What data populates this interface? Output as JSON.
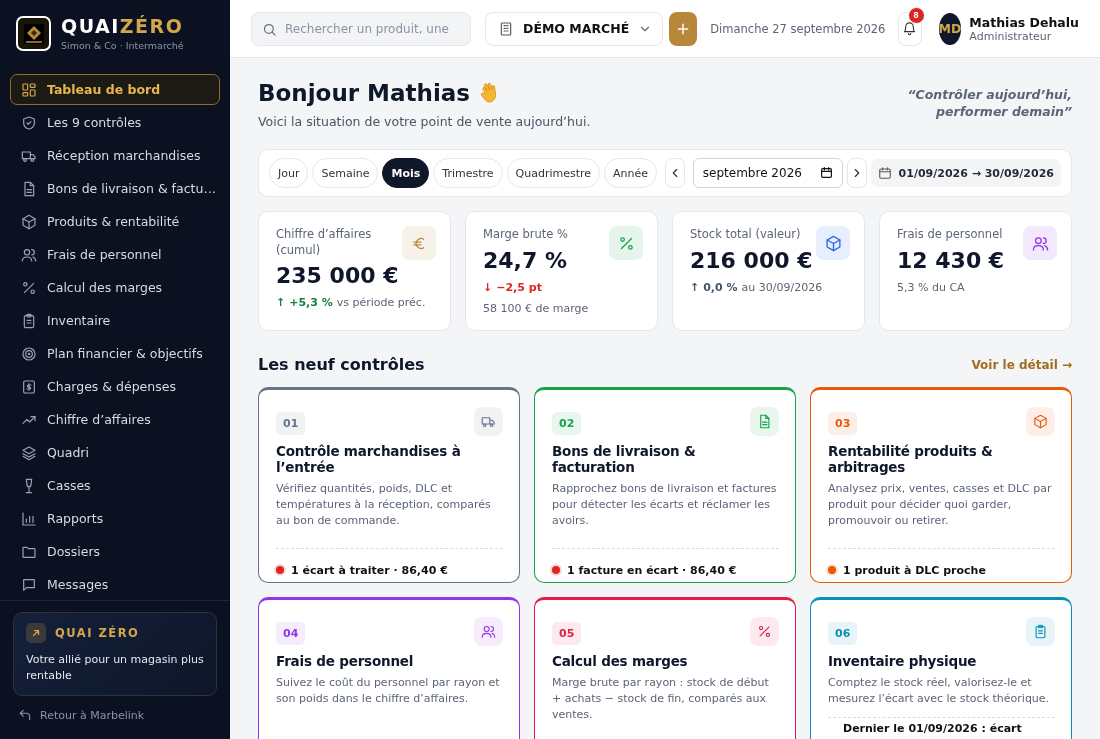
{
  "brand": {
    "name_main": "QUAI",
    "name_accent": "ZÉRO",
    "subtitle": "Simon & Co · Intermarché"
  },
  "sidebar": {
    "items": [
      {
        "label": "Tableau de bord",
        "selected": true
      },
      {
        "label": "Les 9 contrôles",
        "selected": false
      },
      {
        "label": "Réception marchandises",
        "selected": false
      },
      {
        "label": "Bons de livraison & factu…",
        "selected": false
      },
      {
        "label": "Produits & rentabilité",
        "selected": false
      },
      {
        "label": "Frais de personnel",
        "selected": false
      },
      {
        "label": "Calcul des marges",
        "selected": false
      },
      {
        "label": "Inventaire",
        "selected": false
      },
      {
        "label": "Plan financier & objectifs",
        "selected": false
      },
      {
        "label": "Charges & dépenses",
        "selected": false
      },
      {
        "label": "Chiffre d’affaires",
        "selected": false
      },
      {
        "label": "Quadri",
        "selected": false
      },
      {
        "label": "Casses",
        "selected": false
      },
      {
        "label": "Rapports",
        "selected": false
      },
      {
        "label": "Dossiers",
        "selected": false
      },
      {
        "label": "Messages",
        "selected": false
      }
    ],
    "promo": {
      "title": "QUAI ZÉRO",
      "text": "Votre allié pour un magasin plus rentable"
    },
    "back_link": "Retour à Marbelink"
  },
  "topbar": {
    "search": {
      "placeholder": "Rechercher un produit, une"
    },
    "store": "DÉMO MARCHÉ",
    "date": "Dimanche 27 septembre 2026",
    "notifications": "8",
    "user": {
      "initials": "MD",
      "name": "Mathias Dehalu",
      "role": "Administrateur"
    }
  },
  "greeting": {
    "title": "Bonjour Mathias",
    "subtitle": "Voici la situation de votre point de vente aujourd’hui.",
    "quote": "“Contrôler aujourd’hui, performer demain”"
  },
  "period_tabs": [
    {
      "label": "Jour",
      "selected": false
    },
    {
      "label": "Semaine",
      "selected": false
    },
    {
      "label": "Mois",
      "selected": true
    },
    {
      "label": "Trimestre",
      "selected": false
    },
    {
      "label": "Quadrimestre",
      "selected": false
    },
    {
      "label": "Année",
      "selected": false
    }
  ],
  "month_field": {
    "value": "septembre 2026"
  },
  "date_range": "01/09/2026 → 30/09/2026",
  "kpis": [
    {
      "label": "Chiffre d’affaires (cumul)",
      "value": "235 000 €",
      "delta": {
        "arrow": "↑",
        "text": "+5,3 %",
        "color": "#15803d"
      },
      "delta_note": "vs période préc.",
      "color": "#b8873a"
    },
    {
      "label": "Marge brute %",
      "value": "24,7 %",
      "delta": {
        "arrow": "↓",
        "text": "−2,5 pt",
        "color": "#dc2626"
      },
      "note": "58 100 € de marge",
      "color": "#16a34a"
    },
    {
      "label": "Stock total (valeur)",
      "value": "216 000 €",
      "delta": {
        "arrow": "↑",
        "text": "0,0 %",
        "color": "#475569"
      },
      "delta_note": "au 30/09/2026",
      "color": "#2563eb"
    },
    {
      "label": "Frais de personnel",
      "value": "12 430 €",
      "note": "5,3 % du CA",
      "color": "#9333ea"
    }
  ],
  "section": {
    "title": "Les neuf contrôles",
    "link": "Voir le détail →"
  },
  "cards": [
    {
      "number": "01",
      "title": "Contrôle marchandises à l’entrée",
      "text": "Vérifiez quantités, poids, DLC et températures à la réception, comparés au bon de commande.",
      "color": "#64748b",
      "footer": {
        "text": "1 écart à traiter · 86,40 €",
        "color": "#dc2626"
      }
    },
    {
      "number": "02",
      "title": "Bons de livraison & facturation",
      "text": "Rapprochez bons de livraison et factures pour détecter les écarts et réclamer les avoirs.",
      "color": "#16a34a",
      "footer": {
        "text": "1 facture en écart · 86,40 €",
        "color": "#dc2626"
      }
    },
    {
      "number": "03",
      "title": "Rentabilité produits & arbitrages",
      "text": "Analysez prix, ventes, casses et DLC par produit pour décider quoi garder, promouvoir ou retirer.",
      "color": "#ea580c",
      "footer": {
        "text": "1 produit à DLC proche",
        "color": "#ea580c"
      }
    },
    {
      "number": "04",
      "title": "Frais de personnel",
      "text": "Suivez le coût du personnel par rayon et son poids dans le chiffre d’affaires.",
      "color": "#9333ea"
    },
    {
      "number": "05",
      "title": "Calcul des marges",
      "text": "Marge brute par rayon : stock de début + achats − stock de fin, comparés aux ventes.",
      "color": "#e11d48"
    },
    {
      "number": "06",
      "title": "Inventaire physique",
      "text": "Comptez le stock réel, valorisez-le et mesurez l’écart avec le stock théorique.",
      "color": "#0891b2",
      "footer": {
        "text": "Dernier le 01/09/2026 : écart"
      }
    }
  ]
}
